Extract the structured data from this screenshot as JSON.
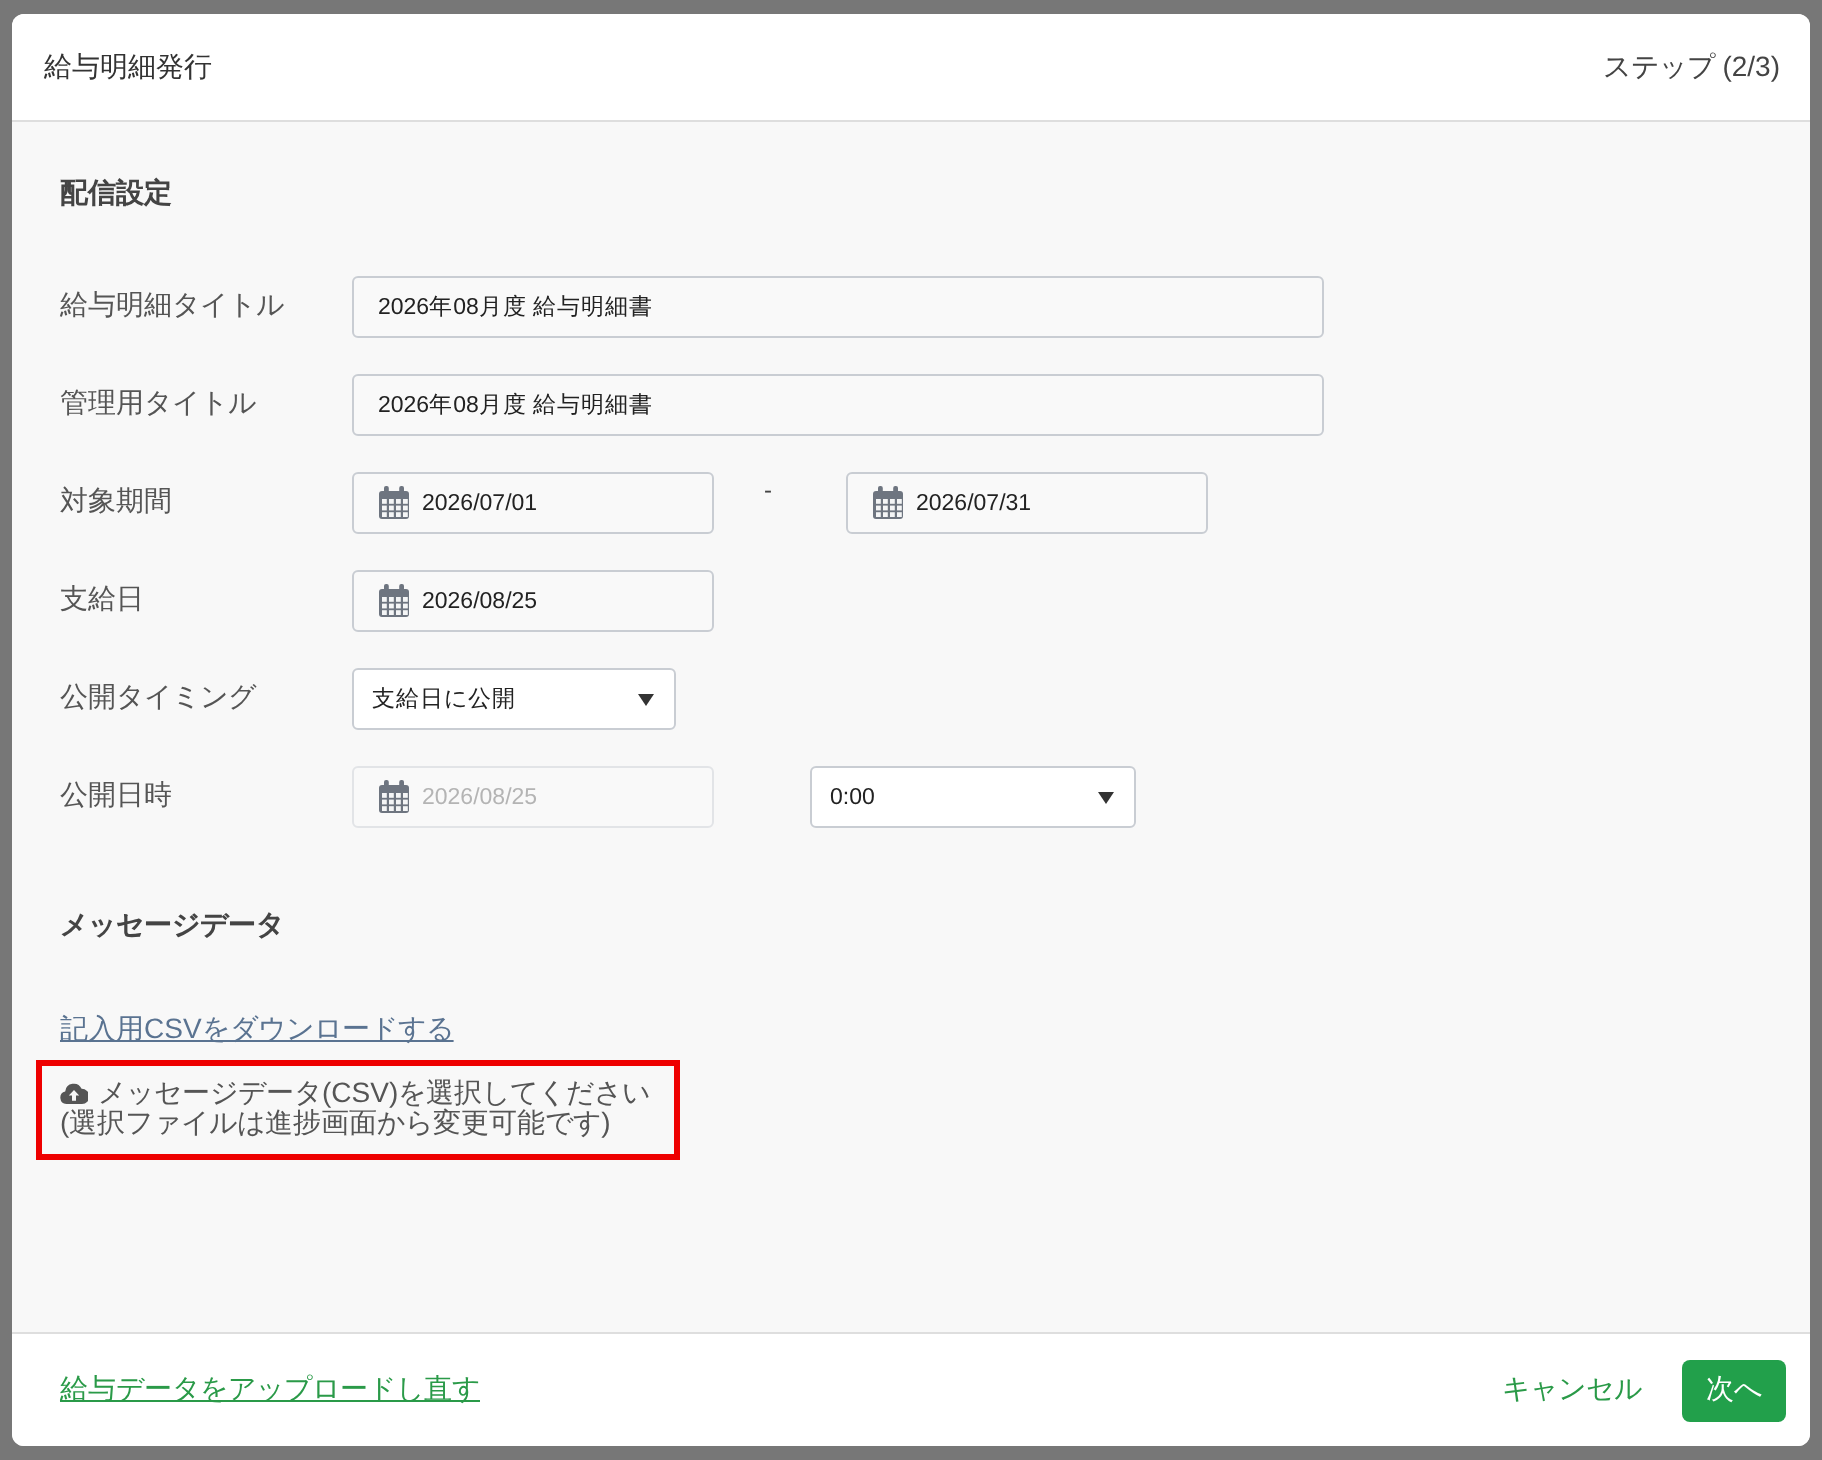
{
  "dialog": {
    "title": "給与明細発行",
    "step": "ステップ (2/3)"
  },
  "sections": [
    {
      "kind": "form",
      "heading": "配信設定",
      "fields": [
        {
          "label": "給与明細タイトル",
          "controls": [
            {
              "kind": "text",
              "value": "2026年08月度 給与明細書"
            }
          ]
        },
        {
          "label": "管理用タイトル",
          "controls": [
            {
              "kind": "text",
              "value": "2026年08月度 給与明細書"
            }
          ]
        },
        {
          "label": "対象期間",
          "controls": [
            {
              "kind": "date",
              "value": "2026/07/01",
              "disabled": false
            },
            {
              "kind": "separator",
              "text": "-"
            },
            {
              "kind": "date",
              "value": "2026/07/31",
              "disabled": false
            }
          ]
        },
        {
          "label": "支給日",
          "controls": [
            {
              "kind": "date",
              "value": "2026/08/25",
              "disabled": false
            }
          ]
        },
        {
          "label": "公開タイミング",
          "controls": [
            {
              "kind": "select",
              "value": "支給日に公開"
            }
          ]
        },
        {
          "label": "公開日時",
          "controls": [
            {
              "kind": "date",
              "value": "2026/08/25",
              "disabled": true
            },
            {
              "kind": "select",
              "value": "0:00"
            }
          ]
        }
      ]
    },
    {
      "kind": "upload",
      "heading": "メッセージデータ",
      "download_link": "記入用CSVをダウンロードする",
      "file_prompt": {
        "highlighted": true,
        "lines": [
          "メッセージデータ(CSV)を選択してください",
          "(選択ファイルは進捗画面から変更可能です)"
        ]
      }
    }
  ],
  "footer": {
    "reupload_link": "給与データをアップロードし直す",
    "cancel": "キャンセル",
    "next": "次へ"
  }
}
